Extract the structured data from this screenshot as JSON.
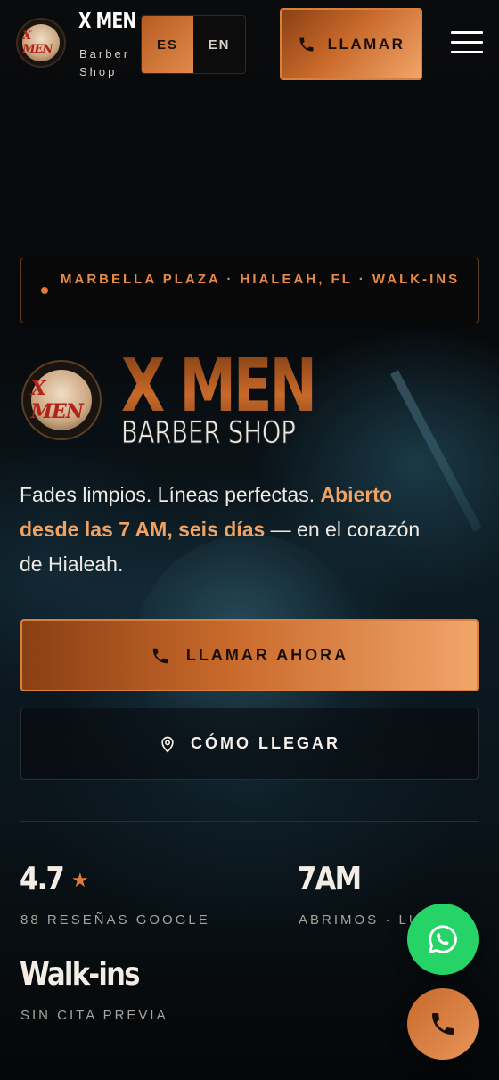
{
  "header": {
    "brand_title": "X MEN",
    "brand_subtitle": "Barber Shop",
    "logo_text": "X MEN",
    "lang_options": [
      "ES",
      "EN"
    ],
    "lang_selected": "ES",
    "call_label": "LLAMAR"
  },
  "hero": {
    "location": "MARBELLA PLAZA · HIALEAH, FL · WALK-INS",
    "logo_title": "X MEN",
    "logo_subtitle": "BARBER SHOP",
    "badge_text": "X MEN",
    "tagline_start": "Fades limpios. Líneas perfectas. ",
    "tagline_highlight": "Abierto desde las 7 AM, seis días",
    "tagline_end": " — en el corazón de Hialeah.",
    "primary_button": "LLAMAR AHORA",
    "secondary_button": "CÓMO LLEGAR"
  },
  "stats": [
    {
      "value": "4.7",
      "label": "88 RESEÑAS GOOGLE"
    },
    {
      "value": "7AM",
      "label": "ABRIMOS · LU–SA"
    },
    {
      "value": "Walk-ins",
      "label": "SIN CITA PREVIA"
    }
  ],
  "colors": {
    "accent": "#e07a35",
    "accent_light": "#f2a56a",
    "whatsapp": "#25d366",
    "background": "#050607"
  },
  "icons": {
    "phone": "phone-icon",
    "pin": "map-pin-icon",
    "star": "star-icon",
    "whatsapp": "whatsapp-icon",
    "menu": "hamburger-menu-icon"
  }
}
